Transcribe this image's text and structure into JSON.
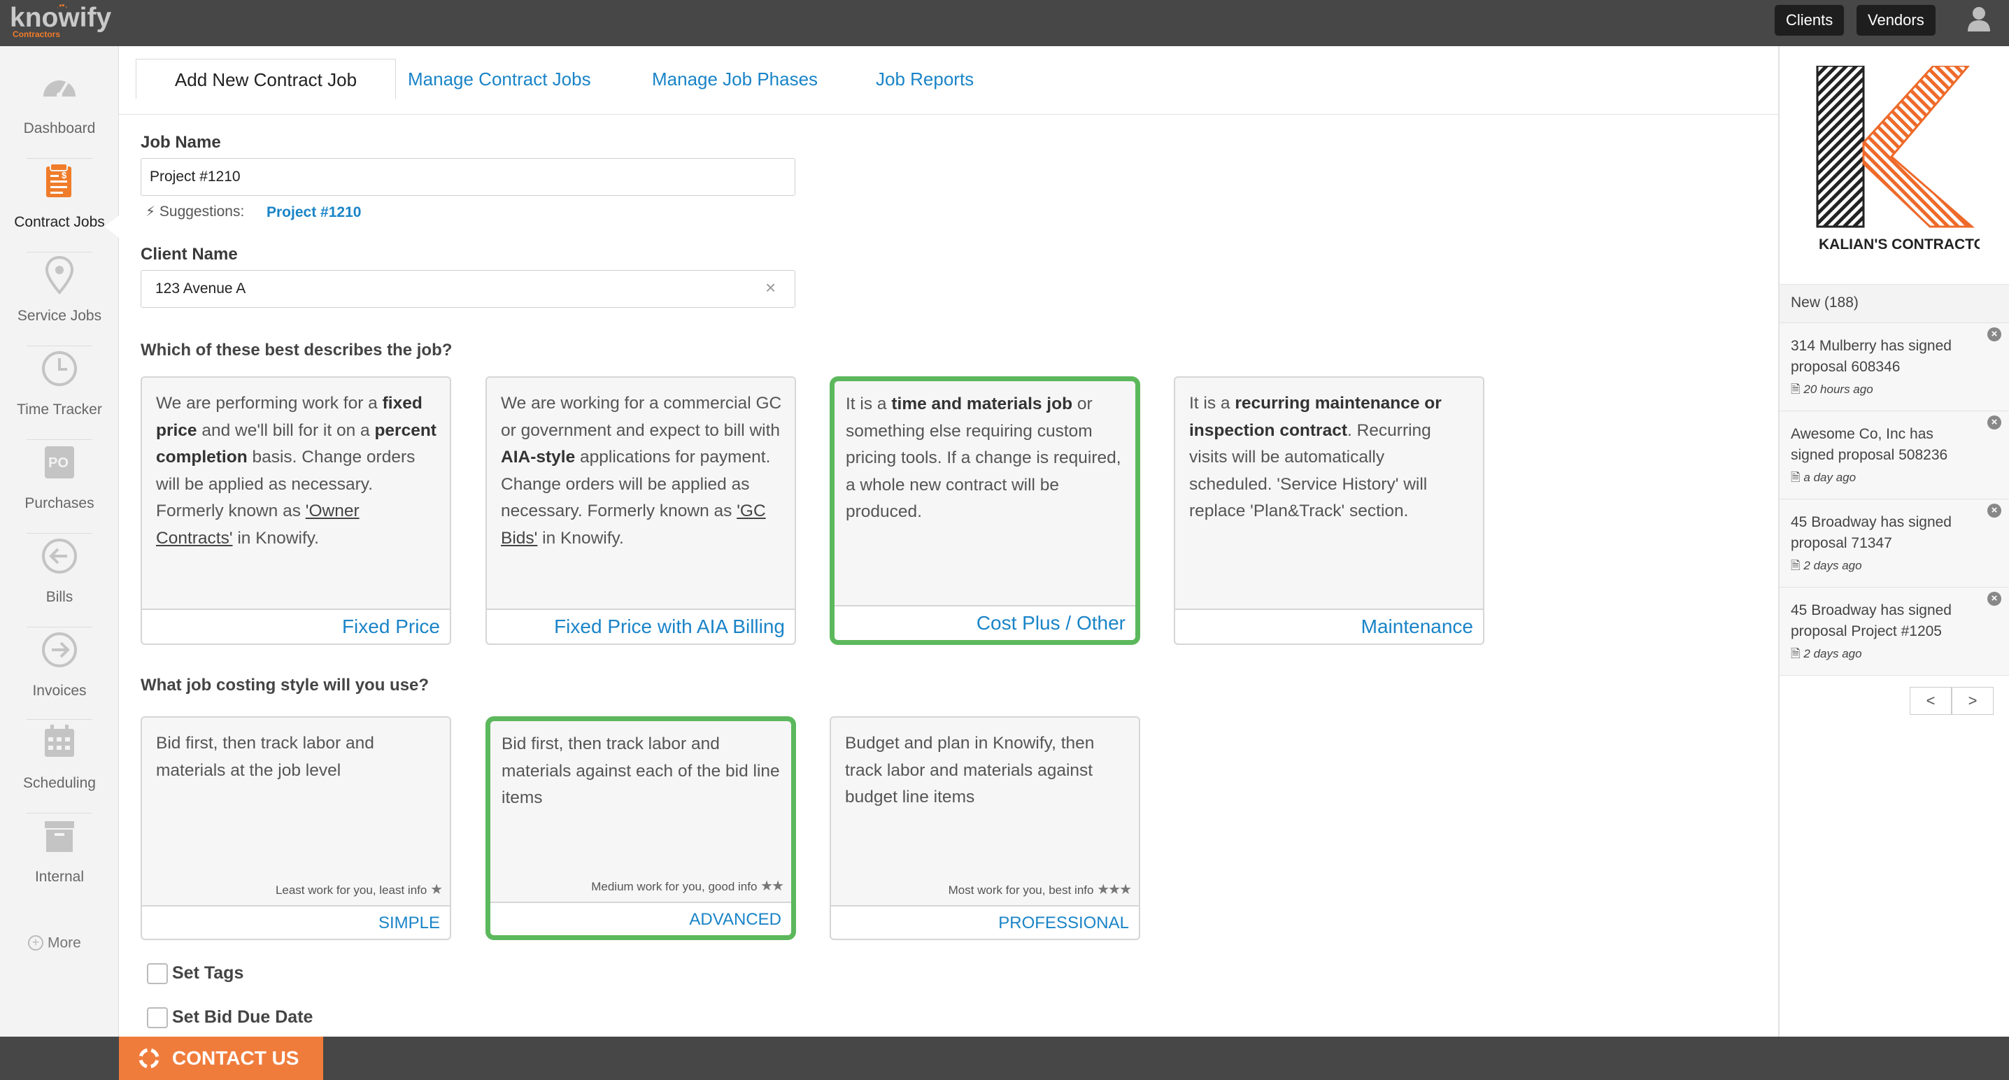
{
  "brand": {
    "name": "knowify",
    "sub": "Contractors"
  },
  "topbar": {
    "clients_label": "Clients",
    "vendors_label": "Vendors"
  },
  "sidebar": {
    "items": [
      {
        "label": "Dashboard",
        "icon": "dashboard-gauge-icon"
      },
      {
        "label": "Contract Jobs",
        "icon": "contract-document-icon"
      },
      {
        "label": "Service Jobs",
        "icon": "map-pin-icon"
      },
      {
        "label": "Time Tracker",
        "icon": "clock-icon"
      },
      {
        "label": "Purchases",
        "icon": "purchase-order-icon"
      },
      {
        "label": "Bills",
        "icon": "arrow-left-circle-icon"
      },
      {
        "label": "Invoices",
        "icon": "arrow-right-circle-icon"
      },
      {
        "label": "Scheduling",
        "icon": "calendar-icon"
      },
      {
        "label": "Internal",
        "icon": "archive-box-icon"
      }
    ],
    "more_label": "More",
    "colors": {
      "active_icon": "#f07c2a",
      "inactive_icon": "#c4c4c4"
    }
  },
  "tabs": [
    {
      "label": "Add New Contract Job"
    },
    {
      "label": "Manage Contract Jobs"
    },
    {
      "label": "Manage Job Phases"
    },
    {
      "label": "Job Reports"
    }
  ],
  "form": {
    "job_name_label": "Job Name",
    "job_name_value": "Project #1210",
    "suggestions_label": "Suggestions:",
    "suggestion_link": "Project #1210",
    "client_name_label": "Client Name",
    "client_name_value": "123 Avenue A",
    "q1": "Which of these best describes the job?",
    "q2": "What job costing style will you use?",
    "set_tags_label": "Set Tags",
    "set_bid_due_label": "Set Bid Due Date"
  },
  "job_types": [
    {
      "footer": "Fixed Price",
      "selected": false
    },
    {
      "footer": "Fixed Price with AIA Billing",
      "selected": false
    },
    {
      "footer": "Cost Plus / Other",
      "selected": true
    },
    {
      "footer": "Maintenance",
      "selected": false
    }
  ],
  "job_type_text": {
    "fixed": {
      "p1": "We are performing work for a ",
      "b1": "fixed price",
      "p2": " and we'll bill for it on a ",
      "b2": "percent completion",
      "p3": " basis. Change orders will be applied as necessary. Formerly known as ",
      "u1": "'Owner Contracts'",
      "p4": " in Knowify."
    },
    "aia": {
      "p1": "We are working for a commercial GC or government and expect to bill with ",
      "b1": "AIA-style",
      "p2": " applications for payment. Change orders will be applied as necessary. Formerly known as ",
      "u1": "'GC Bids'",
      "p3": " in Knowify."
    },
    "cost_plus": {
      "p1": "It is a ",
      "b1": "time and materials job",
      "p2": " or something else requiring custom pricing tools. If a change is required, a whole new contract will be produced."
    },
    "maintenance": {
      "p1": "It is a ",
      "b1": "recurring maintenance or inspection contract",
      "p2": ". Recurring visits will be automatically scheduled. 'Service History' will replace 'Plan&Track' section."
    }
  },
  "costing_styles": [
    {
      "desc": "Bid first, then track labor and materials at the job level",
      "hint": "Least work for you, least info",
      "stars": "★",
      "footer": "SIMPLE",
      "selected": false
    },
    {
      "desc": "Bid first, then track labor and materials against each of the bid line items",
      "hint": "Medium work for you, good info",
      "stars": "★★",
      "footer": "ADVANCED",
      "selected": true
    },
    {
      "desc": "Budget and plan in Knowify, then track labor and materials against budget line items",
      "hint": "Most work for you, best info",
      "stars": "★★★",
      "footer": "PROFESSIONAL",
      "selected": false
    }
  ],
  "right_panel": {
    "company_logo_text": "KALIAN'S CONTRACTORS",
    "new_header": "New (188)",
    "notifications": [
      {
        "text": "314 Mulberry has signed proposal 608346",
        "time": "20 hours ago"
      },
      {
        "text": "Awesome Co, Inc has signed proposal 508236",
        "time": "a day ago"
      },
      {
        "text": "45 Broadway has signed proposal 71347",
        "time": "2 days ago"
      },
      {
        "text": "45 Broadway has signed proposal Project #1205",
        "time": "2 days ago"
      }
    ],
    "prev_label": "<",
    "next_label": ">"
  },
  "footer": {
    "contact_label": "CONTACT US"
  },
  "colors": {
    "link": "#1a84c7",
    "accent": "#f07c3c",
    "selected_border": "#5cb85c",
    "topbar": "#474747"
  }
}
